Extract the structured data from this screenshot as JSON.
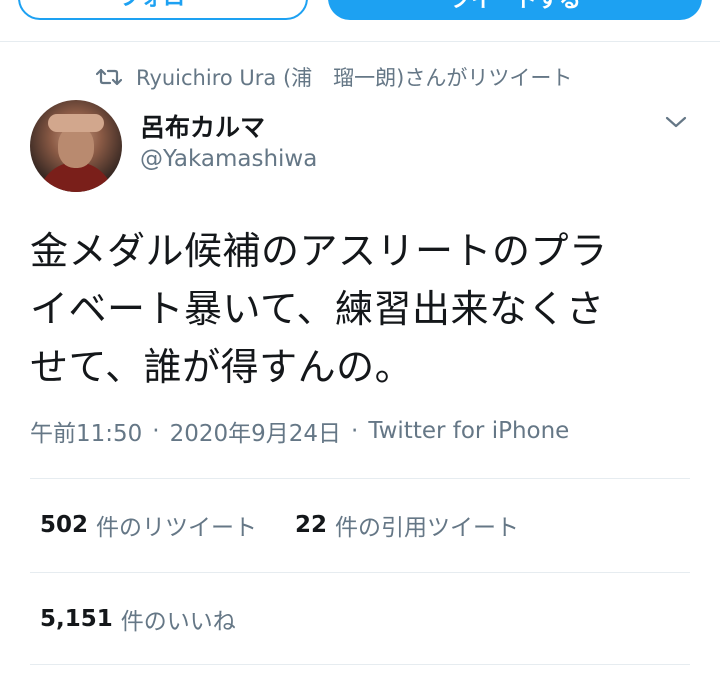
{
  "top_buttons": {
    "left_label": "フォロー",
    "right_label": "ツイートする"
  },
  "retweet_context": {
    "icon": "retweet-icon",
    "text": "Ryuichiro Ura (浦　瑠一朗)さんがリツイート"
  },
  "author": {
    "display_name": "呂布カルマ",
    "handle": "@Yakamashiwa",
    "menu_icon": "chevron-down-icon"
  },
  "tweet": {
    "lines": [
      "金メダル候補のアスリートのプラ",
      "イベート暴いて、練習出来なくさ",
      "せて、誰が得すんの。"
    ]
  },
  "meta": {
    "time": "午前11:50",
    "separator": "·",
    "date": "2020年9月24日",
    "source": "Twitter for iPhone"
  },
  "stats": {
    "retweets": {
      "count": "502",
      "label": "件のリツイート"
    },
    "quotes": {
      "count": "22",
      "label": "件の引用ツイート"
    },
    "likes": {
      "count": "5,151",
      "label": "件のいいね"
    }
  },
  "colors": {
    "accent": "#1da1f2",
    "text": "#14171a",
    "secondary": "#657786",
    "divider": "#e6ecf0"
  }
}
